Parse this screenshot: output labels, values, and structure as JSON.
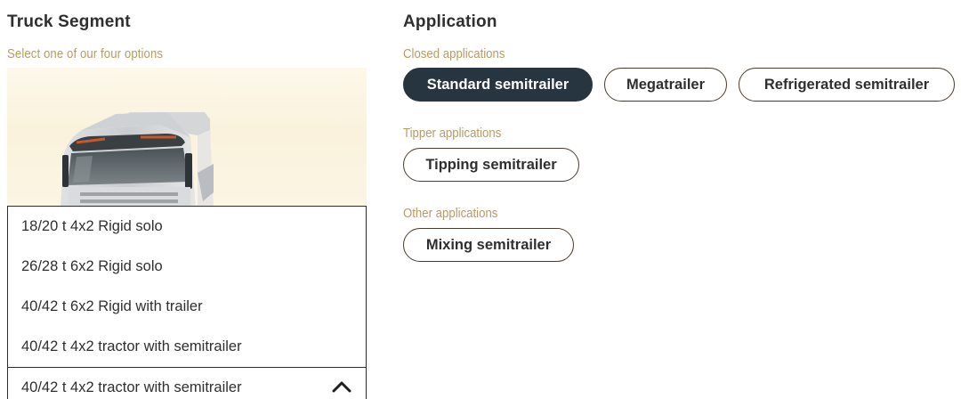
{
  "truck_segment": {
    "title": "Truck Segment",
    "subtitle": "Select one of our four options",
    "options": [
      "18/20 t 4x2 Rigid solo",
      "26/28 t 6x2 Rigid solo",
      "40/42 t 6x2 Rigid with trailer",
      "40/42 t 4x2 tractor with semitrailer"
    ],
    "selected": "40/42 t 4x2 tractor with semitrailer",
    "toggle_icon": "chevron-up-icon"
  },
  "application": {
    "title": "Application",
    "groups": [
      {
        "label": "Closed applications",
        "options": [
          "Standard semitrailer",
          "Megatrailer",
          "Refrigerated semitrailer"
        ],
        "selected": "Standard semitrailer"
      },
      {
        "label": "Tipper applications",
        "options": [
          "Tipping semitrailer"
        ]
      },
      {
        "label": "Other applications",
        "options": [
          "Mixing semitrailer"
        ]
      }
    ]
  },
  "colors": {
    "accent_label": "#b89a63",
    "active_chip": "#273540",
    "chip_border": "#4a3c2c",
    "text": "#2f2f2f"
  }
}
